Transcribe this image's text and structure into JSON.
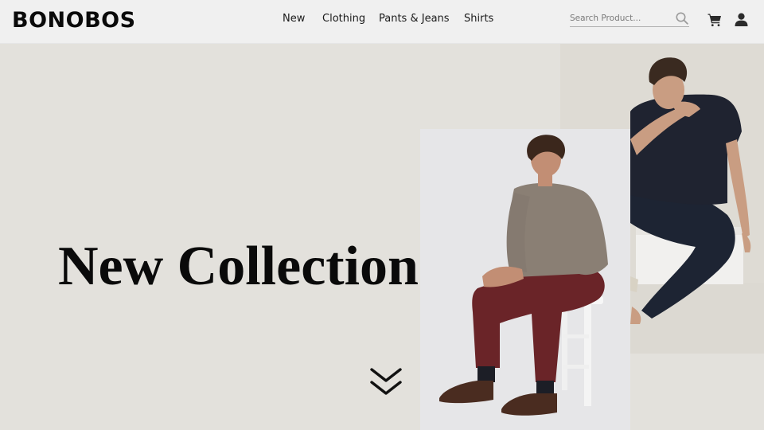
{
  "header": {
    "logo": "BONOBOS",
    "nav": [
      {
        "label": "New"
      },
      {
        "label": "Clothing"
      },
      {
        "label": "Pants & Jeans"
      },
      {
        "label": "Shirts"
      }
    ],
    "search": {
      "placeholder": "Search Product...",
      "value": "",
      "icon": "search-icon"
    },
    "icons": {
      "cart": "cart-icon",
      "account": "user-icon"
    }
  },
  "hero": {
    "title": "New Collection",
    "scroll_icon": "double-chevron-down-icon",
    "images": [
      {
        "alt": "Man in grey sweater and burgundy pants seated on white stool"
      },
      {
        "alt": "Man in navy t-shirt and dark jeans seated on white block"
      }
    ]
  },
  "colors": {
    "header_bg": "#f0f0f0",
    "hero_bg": "#e3e1dc",
    "text": "#0a0a0a"
  }
}
